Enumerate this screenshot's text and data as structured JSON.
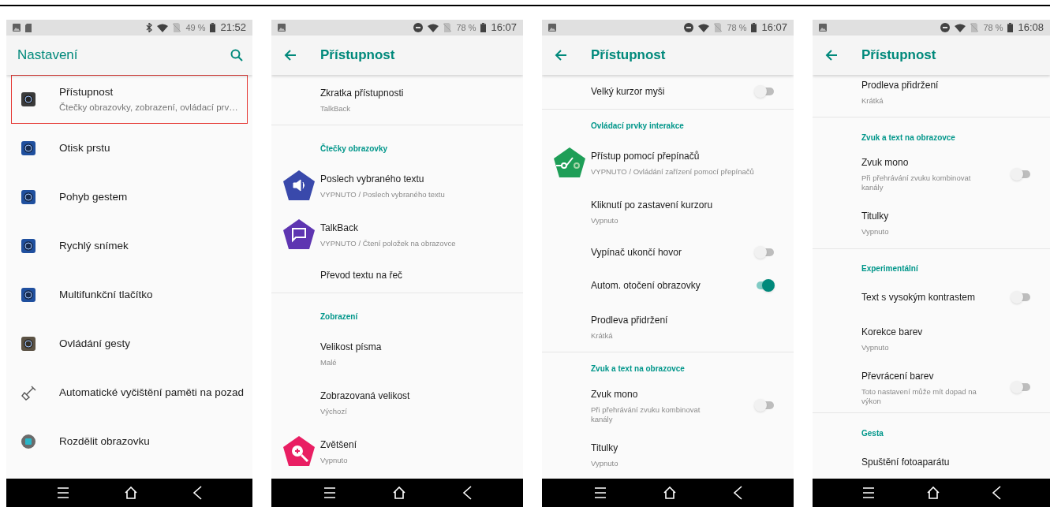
{
  "panels": [
    {
      "kind": "list",
      "status": {
        "battery": "49 %",
        "time": "21:52"
      },
      "app_bar": {
        "title": "Nastavení",
        "back": false,
        "search": true
      },
      "items": [
        {
          "kind": "item",
          "color": "#3a3a3a",
          "title": "Přístupnost",
          "subtitle": "Čtečky obrazovky, zobrazení, ovládací prv…",
          "highlighted": true
        },
        {
          "kind": "item",
          "color": "#1f4f9e",
          "title": "Otisk prstu",
          "highlighted": false
        },
        {
          "kind": "item",
          "color": "#1f4f9e",
          "title": "Pohyb gestem",
          "highlighted": false
        },
        {
          "kind": "item",
          "color": "#1f4f9e",
          "title": "Rychlý snímek",
          "highlighted": false
        },
        {
          "kind": "item",
          "color": "#1f4f9e",
          "title": "Multifunkční tlačítko",
          "highlighted": false
        },
        {
          "kind": "item",
          "color": "#5b5244",
          "title": "Ovládání gesty",
          "highlighted": false
        },
        {
          "kind": "item",
          "title": "Automatické vyčištění paměti na pozad",
          "highlighted": false
        },
        {
          "kind": "item",
          "color": "#6b6b6b",
          "title": "Rozdělit obrazovku",
          "highlighted": false
        }
      ]
    },
    {
      "kind": "settings",
      "status": {
        "battery": "78 %",
        "time": "16:07"
      },
      "app_bar": {
        "title": "Přístupnost",
        "back": true,
        "search": false
      },
      "items": [
        {
          "kind": "item",
          "title": "Zkratka přístupnosti",
          "subtitle": "TalkBack"
        },
        {
          "kind": "divider"
        },
        {
          "kind": "header",
          "title": "Čtečky obrazovky"
        },
        {
          "kind": "item",
          "color": "#3949ab",
          "title": "Poslech vybraného textu",
          "subtitle": "VYPNUTO / Poslech vybraného textu"
        },
        {
          "kind": "item",
          "color": "#5e35b1",
          "title": "TalkBack",
          "subtitle": "VYPNUTO / Čtení položek na obrazovce"
        },
        {
          "kind": "item",
          "title": "Převod textu na řeč"
        },
        {
          "kind": "divider"
        },
        {
          "kind": "header",
          "title": "Zobrazení"
        },
        {
          "kind": "item",
          "title": "Velikost písma",
          "subtitle": "Malé"
        },
        {
          "kind": "item",
          "title": "Zobrazovaná velikost",
          "subtitle": "Výchozí"
        },
        {
          "kind": "item",
          "color": "#e91e63",
          "title": "Zvětšení",
          "subtitle": "Vypnuto"
        }
      ]
    },
    {
      "kind": "settings",
      "status": {
        "battery": "78 %",
        "time": "16:07"
      },
      "app_bar": {
        "title": "Přístupnost",
        "back": true,
        "search": false
      },
      "items": [
        {
          "kind": "item",
          "title": "Velký kurzor myši",
          "on": false
        },
        {
          "kind": "divider"
        },
        {
          "kind": "header",
          "title": "Ovládací prvky interakce"
        },
        {
          "kind": "item",
          "color": "#1e9e57",
          "title": "Přístup pomocí přepínačů",
          "subtitle": "VYPNUTO / Ovládání zařízení pomocí přepínačů"
        },
        {
          "kind": "item",
          "title": "Kliknutí po zastavení kurzoru",
          "subtitle": "Vypnuto"
        },
        {
          "kind": "item",
          "title": "Vypínač ukončí hovor",
          "on": false
        },
        {
          "kind": "item",
          "title": "Autom. otočení obrazovky",
          "on": true
        },
        {
          "kind": "item",
          "title": "Prodleva přidržení",
          "subtitle": "Krátká"
        },
        {
          "kind": "divider"
        },
        {
          "kind": "header",
          "title": "Zvuk a text na obrazovce"
        },
        {
          "kind": "item",
          "title": "Zvuk mono",
          "subtitle": "Při přehrávání zvuku kombinovat kanály",
          "on": false
        },
        {
          "kind": "item",
          "title": "Titulky",
          "subtitle": "Vypnuto"
        }
      ]
    },
    {
      "kind": "settings",
      "status": {
        "battery": "78 %",
        "time": "16:08"
      },
      "app_bar": {
        "title": "Přístupnost",
        "back": true,
        "search": false
      },
      "items": [
        {
          "kind": "item",
          "title": "Prodleva přidržení",
          "subtitle": "Krátká"
        },
        {
          "kind": "divider"
        },
        {
          "kind": "header",
          "title": "Zvuk a text na obrazovce"
        },
        {
          "kind": "item",
          "title": "Zvuk mono",
          "subtitle": "Při přehrávání zvuku kombinovat kanály",
          "on": false
        },
        {
          "kind": "item",
          "title": "Titulky",
          "subtitle": "Vypnuto"
        },
        {
          "kind": "divider"
        },
        {
          "kind": "header",
          "title": "Experimentální"
        },
        {
          "kind": "item",
          "title": "Text s vysokým kontrastem",
          "on": false
        },
        {
          "kind": "item",
          "title": "Korekce barev",
          "subtitle": "Vypnuto"
        },
        {
          "kind": "item",
          "title": "Převrácení barev",
          "subtitle": "Toto nastavení může mít dopad na výkon",
          "on": false
        },
        {
          "kind": "divider"
        },
        {
          "kind": "header",
          "title": "Gesta"
        },
        {
          "kind": "item",
          "title": "Spuštění fotoaparátu"
        }
      ]
    }
  ]
}
